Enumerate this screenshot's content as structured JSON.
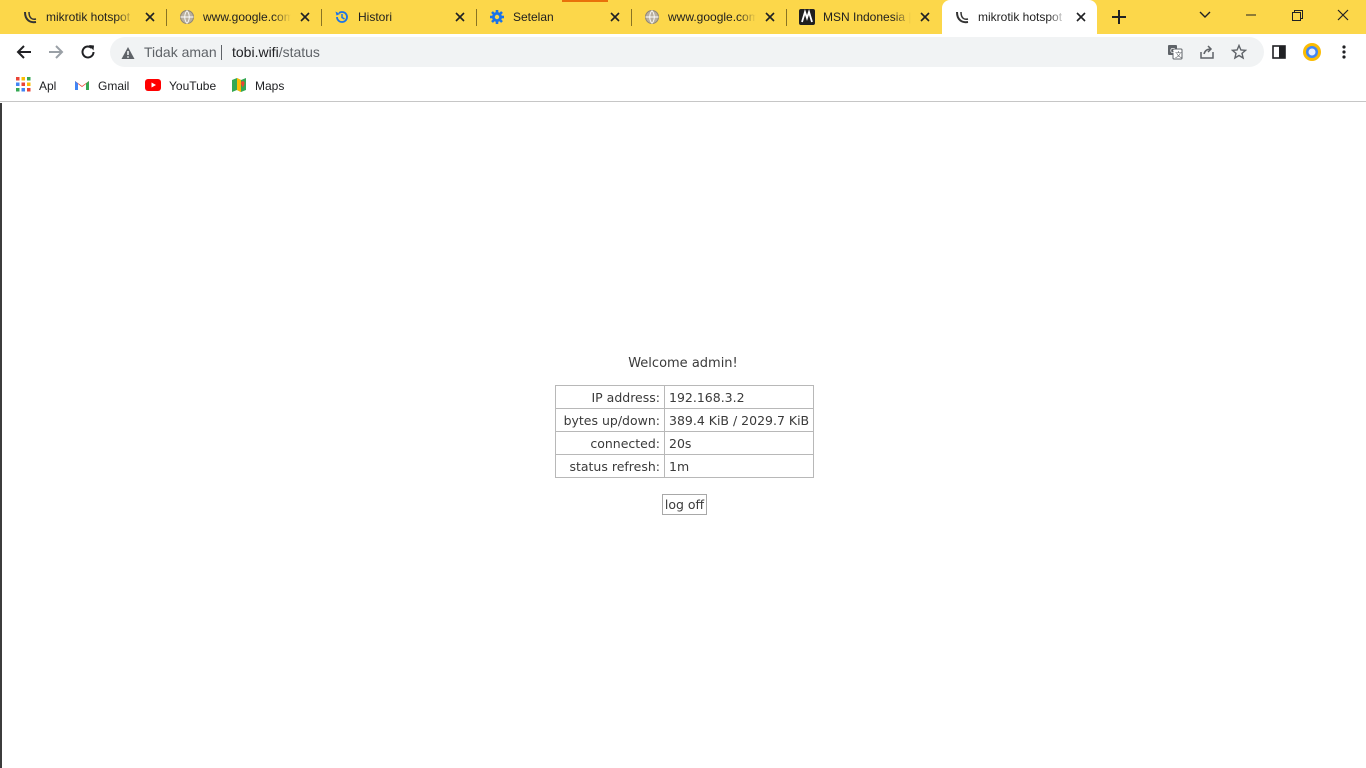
{
  "browser": {
    "tabs": [
      {
        "title": "mikrotik hotspot > status",
        "favicon": "mikrotik-icon",
        "active": false
      },
      {
        "title": "www.google.com",
        "favicon": "globe-icon",
        "active": false
      },
      {
        "title": "Histori",
        "favicon": "history-icon",
        "active": false
      },
      {
        "title": "Setelan",
        "favicon": "settings-gear-icon",
        "active": false
      },
      {
        "title": "www.google.com",
        "favicon": "globe-icon",
        "active": false
      },
      {
        "title": "MSN Indonesia | Berita",
        "favicon": "msn-icon",
        "active": false
      },
      {
        "title": "mikrotik hotspot > status",
        "favicon": "mikrotik-icon",
        "active": true
      }
    ],
    "tabstrip_color": "#fcd74a",
    "omnibox": {
      "security_label": "Tidak aman",
      "url_host": "tobi.wifi",
      "url_path": "/status"
    },
    "bookmarks": [
      {
        "label": "Apl",
        "icon": "apps-grid-icon"
      },
      {
        "label": "Gmail",
        "icon": "gmail-icon"
      },
      {
        "label": "YouTube",
        "icon": "youtube-icon"
      },
      {
        "label": "Maps",
        "icon": "maps-icon"
      }
    ]
  },
  "page": {
    "welcome_text": "Welcome admin!",
    "status_rows": [
      {
        "label": "IP address:",
        "value": "192.168.3.2"
      },
      {
        "label": "bytes up/down:",
        "value": "389.4 KiB / 2029.7 KiB"
      },
      {
        "label": "connected:",
        "value": "20s"
      },
      {
        "label": "status refresh:",
        "value": "1m"
      }
    ],
    "logoff_label": "log off"
  }
}
